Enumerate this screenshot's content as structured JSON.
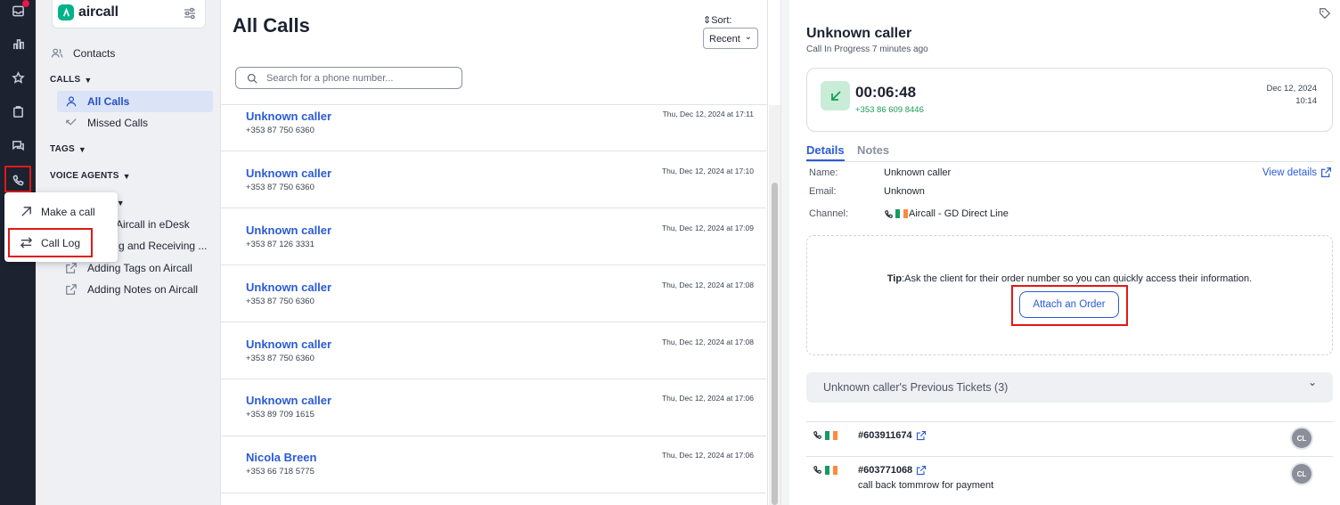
{
  "rail": {
    "icons": [
      "inbox-icon",
      "chart-icon",
      "star-icon",
      "clipboard-icon",
      "chat-icon",
      "phone-icon"
    ]
  },
  "popup": {
    "items": [
      {
        "label": "Make a call",
        "icon": "arrow-up-right-icon"
      },
      {
        "label": "Call Log",
        "icon": "swap-arrows-icon"
      }
    ]
  },
  "nav": {
    "brand": "aircall",
    "contacts": "Contacts",
    "calls_section": "CALLS",
    "all_calls": "All Calls",
    "missed_calls": "Missed Calls",
    "tags_section": "TAGS",
    "voice_agents_section": "VOICE AGENTS",
    "guides_section_partial": "ES",
    "links": [
      "Aircall in eDesk",
      "g and Receiving ...",
      "Adding Tags on Aircall",
      "Adding Notes on Aircall"
    ]
  },
  "calls": {
    "title": "All Calls",
    "sort_label": "Sort:",
    "sort_value": "Recent",
    "search_placeholder": "Search for a phone number...",
    "rows": [
      {
        "name": "Unknown caller",
        "phone": "+353 87 750 6360",
        "time": "Thu, Dec 12, 2024 at 17:11"
      },
      {
        "name": "Unknown caller",
        "phone": "+353 87 750 6360",
        "time": "Thu, Dec 12, 2024 at 17:10"
      },
      {
        "name": "Unknown caller",
        "phone": "+353 87 126 3331",
        "time": "Thu, Dec 12, 2024 at 17:09"
      },
      {
        "name": "Unknown caller",
        "phone": "+353 87 750 6360",
        "time": "Thu, Dec 12, 2024 at 17:08"
      },
      {
        "name": "Unknown caller",
        "phone": "+353 87 750 6360",
        "time": "Thu, Dec 12, 2024 at 17:08"
      },
      {
        "name": "Unknown caller",
        "phone": "+353 89 709 1615",
        "time": "Thu, Dec 12, 2024 at 17:06"
      },
      {
        "name": "Nicola Breen",
        "phone": "+353 66 718 5775",
        "time": "Thu, Dec 12, 2024 at 17:06"
      }
    ]
  },
  "detail": {
    "title": "Unknown caller",
    "subtitle": "Call In Progress 7 minutes ago",
    "call": {
      "timer": "00:06:48",
      "number": "+353 86 609 8446",
      "date": "Dec 12, 2024",
      "time": "10:14"
    },
    "tabs": {
      "details": "Details",
      "notes": "Notes"
    },
    "fields": {
      "name_label": "Name:",
      "name_value": "Unknown caller",
      "email_label": "Email:",
      "email_value": "Unknown",
      "channel_label": "Channel:",
      "channel_value": "Aircall - GD Direct Line"
    },
    "view_details": "View details",
    "tip": {
      "prefix": "Tip",
      "text": ":Ask the client for their order number so you can quickly access their information.",
      "button": "Attach an Order"
    },
    "previous_tickets": {
      "label": "Unknown caller's Previous Tickets (3)",
      "items": [
        {
          "id": "#603911674",
          "note": "",
          "avatar": "CL"
        },
        {
          "id": "#603771068",
          "note": "call back tommrow for payment",
          "avatar": "CL"
        }
      ]
    }
  },
  "colors": {
    "accent": "#2a5bd7",
    "rail": "#1c2230",
    "brand_green": "#00b388",
    "call_green": "#1a9a56",
    "highlight": "#e01818"
  }
}
